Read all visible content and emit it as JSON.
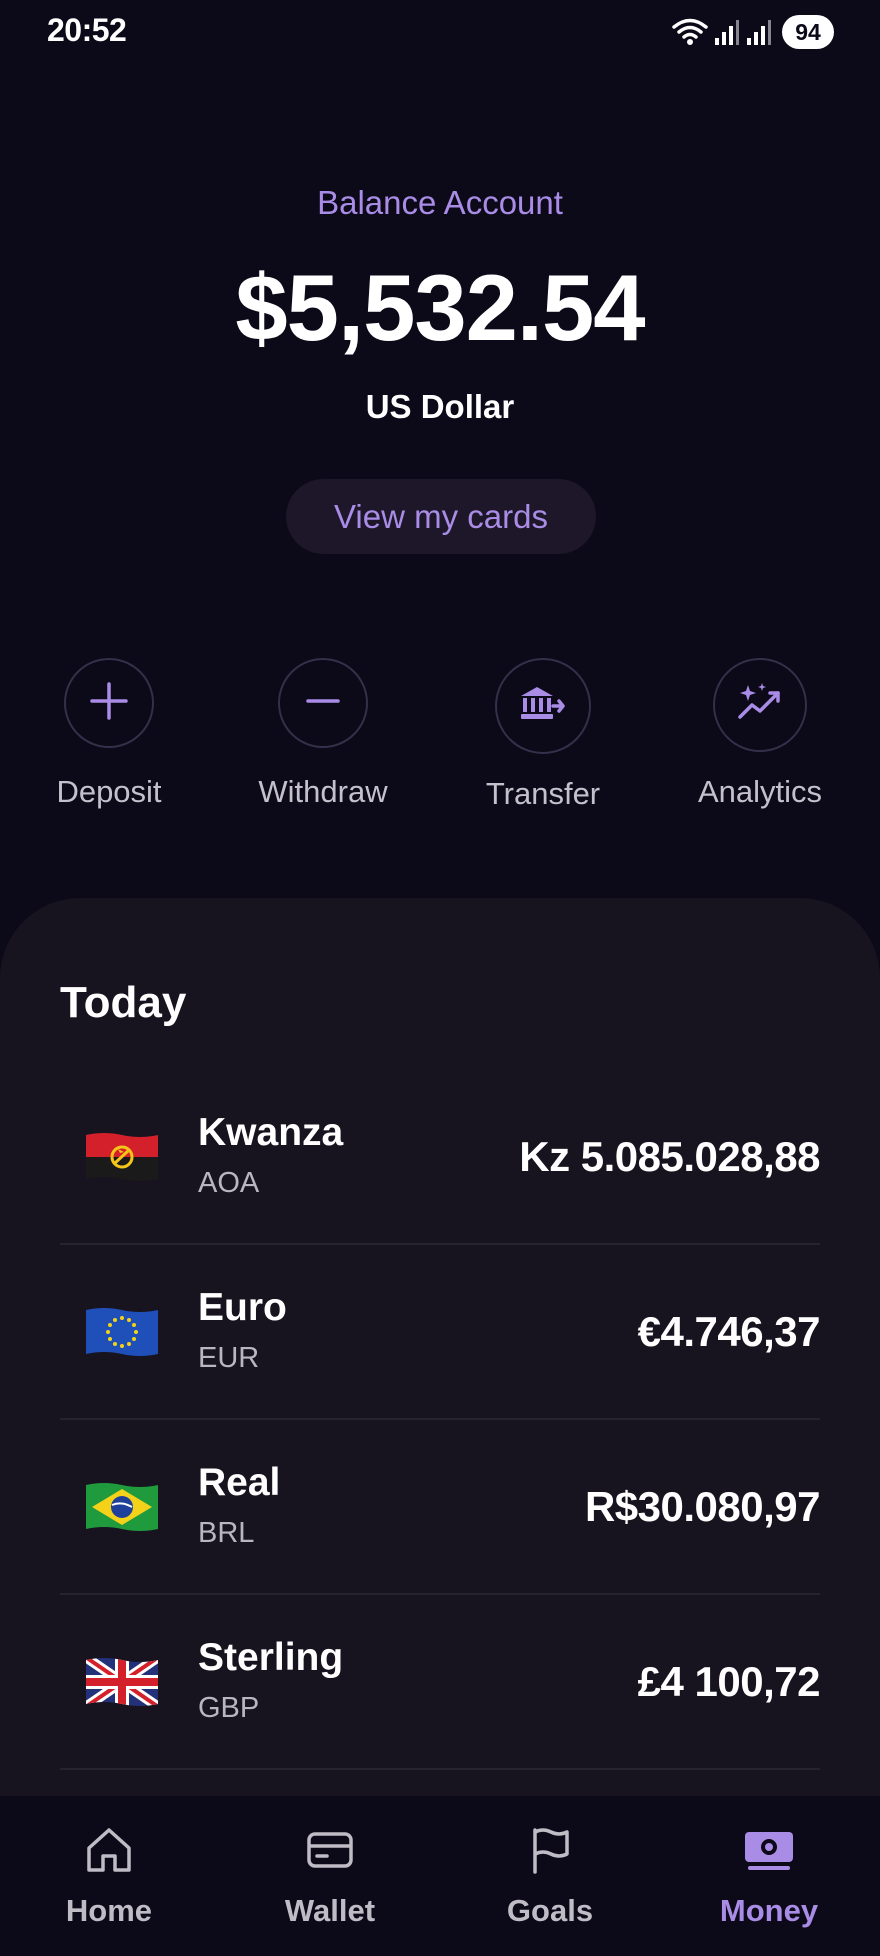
{
  "status_bar": {
    "time": "20:52",
    "battery": "94",
    "icons": [
      "wifi-icon",
      "signal-icon",
      "signal-icon",
      "battery-icon"
    ]
  },
  "balance": {
    "label": "Balance Account",
    "amount": "$5,532.54",
    "currency": "US Dollar",
    "view_cards_label": "View my cards"
  },
  "actions": [
    {
      "label": "Deposit",
      "icon": "plus-icon"
    },
    {
      "label": "Withdraw",
      "icon": "minus-icon"
    },
    {
      "label": "Transfer",
      "icon": "bank-transfer-icon"
    },
    {
      "label": "Analytics",
      "icon": "sparkle-chart-icon"
    }
  ],
  "today": {
    "title": "Today",
    "currencies": [
      {
        "name": "Kwanza",
        "code": "AOA",
        "amount": "Kz 5.085.028,88",
        "flag": "angola-flag-icon"
      },
      {
        "name": "Euro",
        "code": "EUR",
        "amount": "€4.746,37",
        "flag": "eu-flag-icon"
      },
      {
        "name": "Real",
        "code": "BRL",
        "amount": "R$30.080,97",
        "flag": "brazil-flag-icon"
      },
      {
        "name": "Sterling",
        "code": "GBP",
        "amount": "£4 100,72",
        "flag": "uk-flag-icon"
      }
    ]
  },
  "nav": {
    "items": [
      {
        "label": "Home",
        "icon": "home-icon",
        "active": false
      },
      {
        "label": "Wallet",
        "icon": "wallet-icon",
        "active": false
      },
      {
        "label": "Goals",
        "icon": "flag-icon",
        "active": false
      },
      {
        "label": "Money",
        "icon": "money-icon",
        "active": true
      }
    ]
  },
  "colors": {
    "background": "#0c0918",
    "panel": "#18141f",
    "accent": "#a98ce6",
    "button_bg": "#1d1729",
    "text_secondary": "#c4c1cc"
  }
}
